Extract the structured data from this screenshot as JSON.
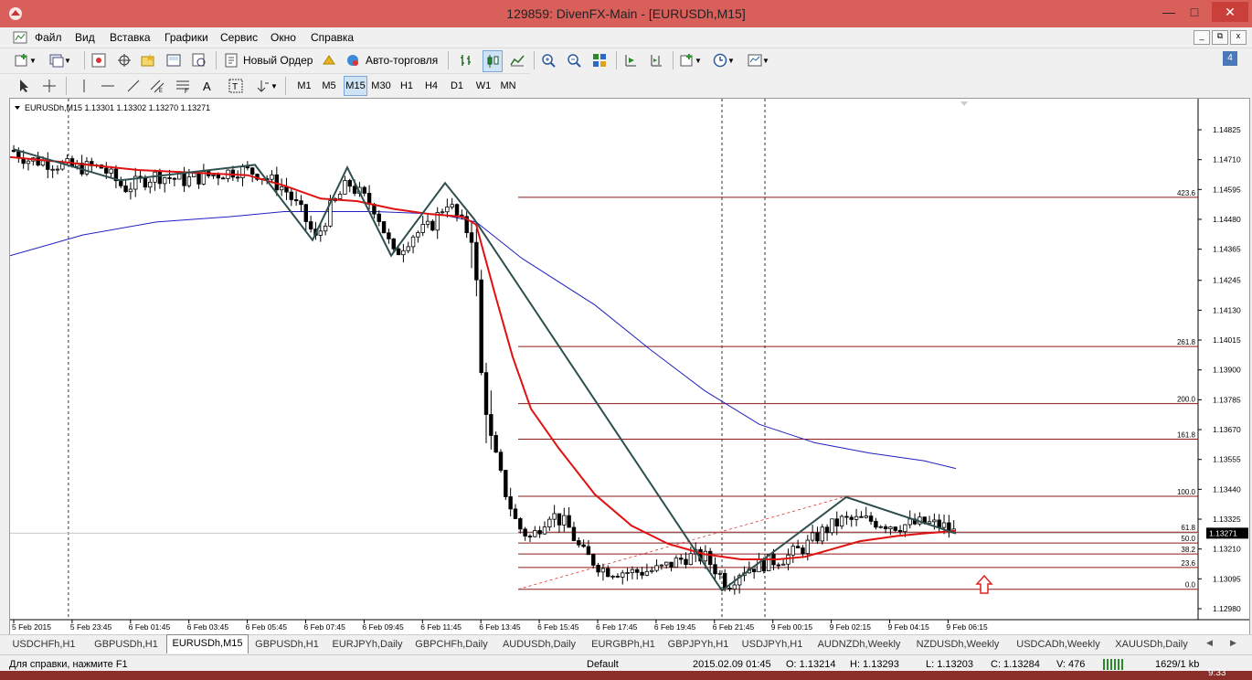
{
  "window": {
    "title": "129859: DivenFX-Main - [EURUSDh,M15]"
  },
  "menu": [
    "Файл",
    "Вид",
    "Вставка",
    "Графики",
    "Сервис",
    "Окно",
    "Справка"
  ],
  "toolbar": {
    "new_order": "Новый Ордер",
    "autotrade": "Авто-торговля"
  },
  "timeframes": [
    "M1",
    "M5",
    "M15",
    "M30",
    "H1",
    "H4",
    "D1",
    "W1",
    "MN"
  ],
  "active_timeframe": "M15",
  "chart": {
    "header": "EURUSDh,M15  1.13301 1.13302 1.13270 1.13271",
    "current_price": "1.13271",
    "price_labels": [
      "1.14825",
      "1.14710",
      "1.14595",
      "1.14480",
      "1.14365",
      "1.14245",
      "1.14130",
      "1.14015",
      "1.13900",
      "1.13785",
      "1.13670",
      "1.13555",
      "1.13440",
      "1.13325",
      "1.13210",
      "1.13095",
      "1.12980"
    ],
    "time_labels": [
      "5 Feb 2015",
      "5 Feb 23:45",
      "6 Feb 01:45",
      "6 Feb 03:45",
      "6 Feb 05:45",
      "6 Feb 07:45",
      "6 Feb 09:45",
      "6 Feb 11:45",
      "6 Feb 13:45",
      "6 Feb 15:45",
      "6 Feb 17:45",
      "6 Feb 19:45",
      "6 Feb 21:45",
      "9 Feb 00:15",
      "9 Feb 02:15",
      "9 Feb 04:15",
      "9 Feb 06:15"
    ],
    "fibo_levels": [
      {
        "label": "423.6",
        "price": 1.14565
      },
      {
        "label": "261.8",
        "price": 1.1399
      },
      {
        "label": "200.0",
        "price": 1.1377
      },
      {
        "label": "161.8",
        "price": 1.13633
      },
      {
        "label": "100.0",
        "price": 1.13413
      },
      {
        "label": "61.8",
        "price": 1.13275
      },
      {
        "label": "50.0",
        "price": 1.13233
      },
      {
        "label": "38.2",
        "price": 1.13191
      },
      {
        "label": "23.6",
        "price": 1.13139
      },
      {
        "label": "0.0",
        "price": 1.13055
      }
    ],
    "colors": {
      "bull": "#ffffff",
      "bear": "#000000",
      "ma_fast": "#e01010",
      "ma_slow": "#2020c0",
      "zigzag": "#2f4f4f",
      "fibo": "#8b1a1a",
      "arrow": "#e02020"
    }
  },
  "tabs": [
    "USDCHFh,H1",
    "GBPUSDh,H1",
    "EURUSDh,M15",
    "GBPUSDh,H1",
    "EURJPYh,Daily",
    "GBPCHFh,Daily",
    "AUDUSDh,Daily",
    "EURGBPh,H1",
    "GBPJPYh,H1",
    "USDJPYh,H1",
    "AUDNZDh,Weekly",
    "NZDUSDh,Weekly",
    "USDCADh,Weekly",
    "XAUUSDh,Daily"
  ],
  "active_tab": "EURUSDh,M15",
  "status": {
    "help": "Для справки, нажмите F1",
    "profile": "Default",
    "datetime": "2015.02.09 01:45",
    "open": "O: 1.13214",
    "high": "H: 1.13293",
    "low": "L: 1.13203",
    "close": "C: 1.13284",
    "volume": "V: 476",
    "traffic": "1629/1 kb"
  },
  "clock": "9:33"
}
